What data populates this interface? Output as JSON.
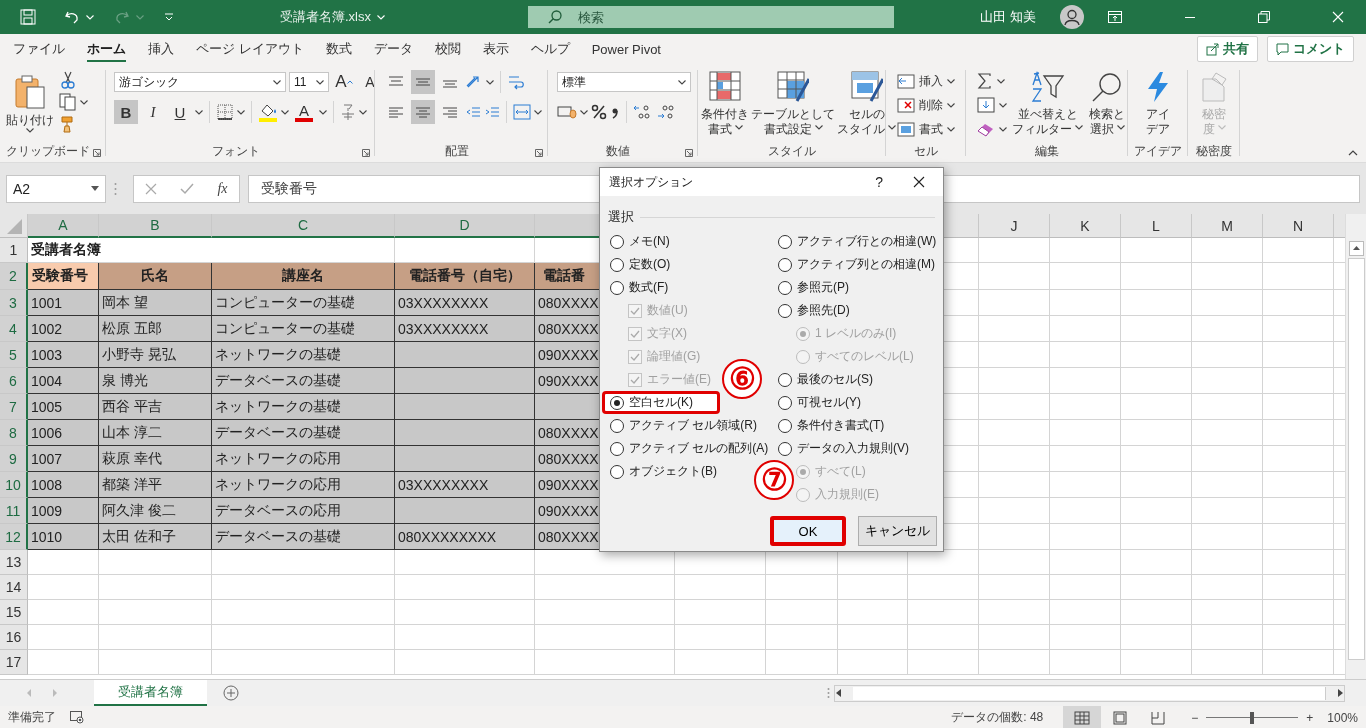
{
  "title_bar": {
    "title": "受講者名簿.xlsx",
    "search": {
      "placeholder": "検索"
    },
    "user": "山田 知美"
  },
  "menu_bar": {
    "tabs": [
      {
        "label": "ファイル",
        "selected": false
      },
      {
        "label": "ホーム",
        "selected": true
      },
      {
        "label": "挿入",
        "selected": false
      },
      {
        "label": "ページ レイアウト",
        "selected": false
      },
      {
        "label": "数式",
        "selected": false
      },
      {
        "label": "データ",
        "selected": false
      },
      {
        "label": "校閲",
        "selected": false
      },
      {
        "label": "表示",
        "selected": false
      },
      {
        "label": "ヘルプ",
        "selected": false
      },
      {
        "label": "Power Pivot",
        "selected": false
      }
    ],
    "share": "共有",
    "comment": "コメント"
  },
  "ribbon": {
    "groups": [
      {
        "kind": "clipboard",
        "label": "クリップボード",
        "paste": "貼り付け"
      },
      {
        "kind": "font",
        "label": "フォント",
        "font_name": "游ゴシック",
        "font_size": "11",
        "grow": "A",
        "shrink": "A",
        "bold": {
          "text": "B",
          "selected": true
        },
        "italic": "I",
        "underline": "U",
        "font_color": "A"
      },
      {
        "kind": "alignment",
        "label": "配置",
        "middle_selected": true,
        "center_selected": true
      },
      {
        "kind": "number",
        "label": "数値",
        "format": "標準"
      },
      {
        "kind": "styles",
        "label": "スタイル",
        "buttons": [
          {
            "lines": [
              "条件付き",
              "書式"
            ]
          },
          {
            "lines": [
              "テーブルとして",
              "書式設定"
            ]
          },
          {
            "lines": [
              "セルの",
              "スタイル"
            ]
          }
        ]
      },
      {
        "kind": "cells",
        "label": "セル",
        "items": [
          {
            "label": "挿入"
          },
          {
            "label": "削除"
          },
          {
            "label": "書式"
          }
        ]
      },
      {
        "kind": "editing",
        "label": "編集",
        "sort": [
          "並べ替えと",
          "フィルター"
        ],
        "find": [
          "検索と",
          "選択"
        ]
      },
      {
        "kind": "ideas",
        "label": "アイデア",
        "lines": [
          "アイ",
          "デア"
        ]
      },
      {
        "kind": "sensitivity",
        "label": "秘密度",
        "lines": [
          "秘密",
          "度"
        ],
        "disabled": true
      }
    ]
  },
  "formula_bar": {
    "name_box": "A2",
    "fx": "fx",
    "formula": "受験番号"
  },
  "sheet": {
    "columns": [
      {
        "label": "A",
        "selected": true
      },
      {
        "label": "B",
        "selected": true
      },
      {
        "label": "C",
        "selected": true
      },
      {
        "label": "D",
        "selected": true
      },
      {
        "selected": true
      },
      {},
      {},
      {},
      {
        "selected": false
      },
      {
        "label": "J",
        "selected": false
      },
      {
        "label": "K",
        "selected": false
      },
      {
        "label": "L",
        "selected": false
      },
      {
        "label": "M",
        "selected": false
      },
      {
        "label": "N",
        "selected": false
      }
    ],
    "rows": [
      {
        "number": "1",
        "kind": "title",
        "selected": false,
        "cells": [
          "受講者名簿"
        ]
      },
      {
        "number": "2",
        "kind": "header",
        "selected": true,
        "cells": [
          {
            "text": "受験番号",
            "active": true
          },
          {
            "text": "氏名",
            "active": false
          },
          {
            "text": "講座名",
            "active": false
          },
          {
            "text": "電話番号（自宅）",
            "active": false
          },
          {
            "text": "電話番",
            "active": false
          }
        ]
      },
      {
        "number": "3",
        "kind": "data",
        "selected": true,
        "cells": [
          "1001",
          "岡本 望",
          "コンピューターの基礎",
          "03XXXXXXXX",
          "080XXXX"
        ]
      },
      {
        "number": "4",
        "kind": "data",
        "selected": true,
        "cells": [
          "1002",
          "松原 五郎",
          "コンピューターの基礎",
          "03XXXXXXXX",
          "080XXXX"
        ]
      },
      {
        "number": "5",
        "kind": "data",
        "selected": true,
        "cells": [
          "1003",
          "小野寺 晃弘",
          "ネットワークの基礎",
          null,
          "090XXXX"
        ]
      },
      {
        "number": "6",
        "kind": "data",
        "selected": true,
        "cells": [
          "1004",
          "泉 博光",
          "データベースの基礎",
          null,
          "090XXXX"
        ]
      },
      {
        "number": "7",
        "kind": "data",
        "selected": true,
        "cells": [
          "1005",
          "西谷 平吉",
          "ネットワークの基礎",
          null,
          null
        ]
      },
      {
        "number": "8",
        "kind": "data",
        "selected": true,
        "cells": [
          "1006",
          "山本 淳二",
          "データベースの基礎",
          null,
          "080XXXX"
        ]
      },
      {
        "number": "9",
        "kind": "data",
        "selected": true,
        "cells": [
          "1007",
          "萩原 幸代",
          "ネットワークの応用",
          null,
          "080XXXX"
        ]
      },
      {
        "number": "10",
        "kind": "data",
        "selected": true,
        "cells": [
          "1008",
          "都築 洋平",
          "ネットワークの応用",
          "03XXXXXXXX",
          "090XXXX"
        ]
      },
      {
        "number": "11",
        "kind": "data",
        "selected": true,
        "cells": [
          "1009",
          "阿久津 俊二",
          "データベースの応用",
          null,
          "090XXXX"
        ]
      },
      {
        "number": "12",
        "kind": "data",
        "selected": true,
        "cells": [
          "1010",
          "太田 佐和子",
          "データベースの基礎",
          "080XXXXXXXX",
          "080XXXX"
        ]
      },
      {
        "number": "13",
        "kind": "empty",
        "selected": false
      },
      {
        "number": "14",
        "kind": "empty",
        "selected": false
      },
      {
        "number": "15",
        "kind": "empty",
        "selected": false
      },
      {
        "number": "16",
        "kind": "empty",
        "selected": false
      },
      {
        "number": "17",
        "kind": "empty",
        "selected": false
      }
    ]
  },
  "sheet_tabs": {
    "tabs": [
      {
        "label": "受講者名簿",
        "selected": true
      }
    ]
  },
  "status_bar": {
    "ready": "準備完了",
    "count": "データの個数: 48",
    "views": [
      {
        "selected": true
      },
      {
        "selected": false
      },
      {
        "selected": false
      }
    ],
    "zoom_out": "−",
    "zoom_in": "+",
    "zoom": {
      "level": 0.5
    },
    "zoom_text": "100%"
  },
  "dialog": {
    "title": "選択オプション",
    "help": "?",
    "group_label": "選択",
    "left_options": [
      {
        "kind": "radio",
        "label": "メモ(N)",
        "selected": false,
        "disabled": false
      },
      {
        "kind": "radio",
        "label": "定数(O)",
        "selected": false,
        "disabled": false
      },
      {
        "kind": "radio",
        "label": "数式(F)",
        "selected": false,
        "disabled": false,
        "children": [
          {
            "kind": "checkbox",
            "label": "数値(U)",
            "checked": true,
            "disabled": true
          },
          {
            "kind": "checkbox",
            "label": "文字(X)",
            "checked": true,
            "disabled": true
          },
          {
            "kind": "checkbox",
            "label": "論理値(G)",
            "checked": true,
            "disabled": true
          },
          {
            "kind": "checkbox",
            "label": "エラー値(E)",
            "checked": true,
            "disabled": true
          }
        ]
      },
      {
        "kind": "radio",
        "label": "空白セル(K)",
        "selected": true,
        "disabled": false,
        "highlighted": true
      },
      {
        "kind": "radio",
        "label": "アクティブ セル領域(R)",
        "selected": false,
        "disabled": false
      },
      {
        "kind": "radio",
        "label": "アクティブ セルの配列(A)",
        "selected": false,
        "disabled": false
      },
      {
        "kind": "radio",
        "label": "オブジェクト(B)",
        "selected": false,
        "disabled": false
      }
    ],
    "right_options": [
      {
        "kind": "radio",
        "label": "アクティブ行との相違(W)",
        "selected": false,
        "disabled": false
      },
      {
        "kind": "radio",
        "label": "アクティブ列との相違(M)",
        "selected": false,
        "disabled": false
      },
      {
        "kind": "radio",
        "label": "参照元(P)",
        "selected": false,
        "disabled": false
      },
      {
        "kind": "radio",
        "label": "参照先(D)",
        "selected": false,
        "disabled": false,
        "children": [
          {
            "kind": "radio",
            "label": "1 レベルのみ(I)",
            "selected": true,
            "disabled": true
          },
          {
            "kind": "radio",
            "label": "すべてのレベル(L)",
            "selected": false,
            "disabled": true
          }
        ]
      },
      {
        "kind": "radio",
        "label": "最後のセル(S)",
        "selected": false,
        "disabled": false
      },
      {
        "kind": "radio",
        "label": "可視セル(Y)",
        "selected": false,
        "disabled": false
      },
      {
        "kind": "radio",
        "label": "条件付き書式(T)",
        "selected": false,
        "disabled": false
      },
      {
        "kind": "radio",
        "label": "データの入力規則(V)",
        "selected": false,
        "disabled": false,
        "children": [
          {
            "kind": "radio",
            "label": "すべて(L)",
            "selected": true,
            "disabled": true
          },
          {
            "kind": "radio",
            "label": "入力規則(E)",
            "selected": false,
            "disabled": true
          }
        ]
      }
    ],
    "buttons": [
      {
        "label": "OK",
        "default": true,
        "highlighted": true
      },
      {
        "label": "キャンセル",
        "default": false,
        "highlighted": false
      }
    ],
    "badges": [
      {
        "label": "⑥"
      },
      {
        "label": "⑦"
      }
    ]
  }
}
